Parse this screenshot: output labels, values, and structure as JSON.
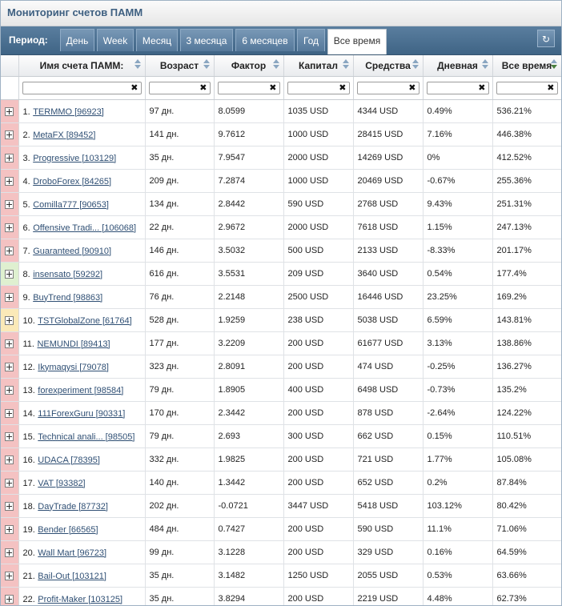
{
  "page": {
    "title": "Мониторинг счетов ПАММ"
  },
  "toolbar": {
    "period_label": "Период:",
    "tabs": [
      "День",
      "Week",
      "Месяц",
      "3 месяца",
      "6 месяцев",
      "Год",
      "Все время"
    ],
    "active_tab": "Все время",
    "refresh_icon": "refresh-icon"
  },
  "columns": [
    "Имя счета ПАММ:",
    "Возраст",
    "Фактор",
    "Капитал",
    "Средства",
    "Дневная",
    "Все время"
  ],
  "sorted_column": "Все время",
  "filters": [
    "",
    "",
    "",
    "",
    "",
    "",
    ""
  ],
  "row_colors": {
    "red": "#f4c2c2",
    "green": "#dff0d0",
    "yellow": "#fbe9b8"
  },
  "rows": [
    {
      "n": "1.",
      "name": "TERMMO [96923]",
      "age": "97 дн.",
      "factor": "8.0599",
      "capital": "1035 USD",
      "funds": "4344 USD",
      "daily": "0.49%",
      "all": "536.21%",
      "color": "red"
    },
    {
      "n": "2.",
      "name": "MetaFX [89452]",
      "age": "141 дн.",
      "factor": "9.7612",
      "capital": "1000 USD",
      "funds": "28415 USD",
      "daily": "7.16%",
      "all": "446.38%",
      "color": "red"
    },
    {
      "n": "3.",
      "name": "Progressive [103129]",
      "age": "35 дн.",
      "factor": "7.9547",
      "capital": "2000 USD",
      "funds": "14269 USD",
      "daily": "0%",
      "all": "412.52%",
      "color": "red"
    },
    {
      "n": "4.",
      "name": "DroboForex [84265]",
      "age": "209 дн.",
      "factor": "7.2874",
      "capital": "1000 USD",
      "funds": "20469 USD",
      "daily": "-0.67%",
      "all": "255.36%",
      "color": "red"
    },
    {
      "n": "5.",
      "name": "Comilla777 [90653]",
      "age": "134 дн.",
      "factor": "2.8442",
      "capital": "590 USD",
      "funds": "2768 USD",
      "daily": "9.43%",
      "all": "251.31%",
      "color": "red"
    },
    {
      "n": "6.",
      "name": "Offensive Tradi... [106068]",
      "age": "22 дн.",
      "factor": "2.9672",
      "capital": "2000 USD",
      "funds": "7618 USD",
      "daily": "1.15%",
      "all": "247.13%",
      "color": "red"
    },
    {
      "n": "7.",
      "name": "Guaranteed [90910]",
      "age": "146 дн.",
      "factor": "3.5032",
      "capital": "500 USD",
      "funds": "2133 USD",
      "daily": "-8.33%",
      "all": "201.17%",
      "color": "red"
    },
    {
      "n": "8.",
      "name": "insensato [59292]",
      "age": "616 дн.",
      "factor": "3.5531",
      "capital": "209 USD",
      "funds": "3640 USD",
      "daily": "0.54%",
      "all": "177.4%",
      "color": "green"
    },
    {
      "n": "9.",
      "name": "BuyTrend [98863]",
      "age": "76 дн.",
      "factor": "2.2148",
      "capital": "2500 USD",
      "funds": "16446 USD",
      "daily": "23.25%",
      "all": "169.2%",
      "color": "red"
    },
    {
      "n": "10.",
      "name": "TSTGlobalZone [61764]",
      "age": "528 дн.",
      "factor": "1.9259",
      "capital": "238 USD",
      "funds": "5038 USD",
      "daily": "6.59%",
      "all": "143.81%",
      "color": "yellow"
    },
    {
      "n": "11.",
      "name": "NEMUNDI [89413]",
      "age": "177 дн.",
      "factor": "3.2209",
      "capital": "200 USD",
      "funds": "61677 USD",
      "daily": "3.13%",
      "all": "138.86%",
      "color": "red"
    },
    {
      "n": "12.",
      "name": "Ikymaqysi [79078]",
      "age": "323 дн.",
      "factor": "2.8091",
      "capital": "200 USD",
      "funds": "474 USD",
      "daily": "-0.25%",
      "all": "136.27%",
      "color": "red"
    },
    {
      "n": "13.",
      "name": "forexperiment [98584]",
      "age": "79 дн.",
      "factor": "1.8905",
      "capital": "400 USD",
      "funds": "6498 USD",
      "daily": "-0.73%",
      "all": "135.2%",
      "color": "red"
    },
    {
      "n": "14.",
      "name": "111ForexGuru [90331]",
      "age": "170 дн.",
      "factor": "2.3442",
      "capital": "200 USD",
      "funds": "878 USD",
      "daily": "-2.64%",
      "all": "124.22%",
      "color": "red"
    },
    {
      "n": "15.",
      "name": "Technical anali... [98505]",
      "age": "79 дн.",
      "factor": "2.693",
      "capital": "300 USD",
      "funds": "662 USD",
      "daily": "0.15%",
      "all": "110.51%",
      "color": "red"
    },
    {
      "n": "16.",
      "name": "UDACA [78395]",
      "age": "332 дн.",
      "factor": "1.9825",
      "capital": "200 USD",
      "funds": "721 USD",
      "daily": "1.77%",
      "all": "105.08%",
      "color": "red"
    },
    {
      "n": "17.",
      "name": "VAT [93382]",
      "age": "140 дн.",
      "factor": "1.3442",
      "capital": "200 USD",
      "funds": "652 USD",
      "daily": "0.2%",
      "all": "87.84%",
      "color": "red"
    },
    {
      "n": "18.",
      "name": "DayTrade [87732]",
      "age": "202 дн.",
      "factor": "-0.0721",
      "capital": "3447 USD",
      "funds": "5418 USD",
      "daily": "103.12%",
      "all": "80.42%",
      "color": "red"
    },
    {
      "n": "19.",
      "name": "Bender [66565]",
      "age": "484 дн.",
      "factor": "0.7427",
      "capital": "200 USD",
      "funds": "590 USD",
      "daily": "11.1%",
      "all": "71.06%",
      "color": "red"
    },
    {
      "n": "20.",
      "name": "Wall Mart [96723]",
      "age": "99 дн.",
      "factor": "3.1228",
      "capital": "200 USD",
      "funds": "329 USD",
      "daily": "0.16%",
      "all": "64.59%",
      "color": "red"
    },
    {
      "n": "21.",
      "name": "Bail-Out [103121]",
      "age": "35 дн.",
      "factor": "3.1482",
      "capital": "1250 USD",
      "funds": "2055 USD",
      "daily": "0.53%",
      "all": "63.66%",
      "color": "red"
    },
    {
      "n": "22.",
      "name": "Profit-Maker [103125]",
      "age": "35 дн.",
      "factor": "3.8294",
      "capital": "200 USD",
      "funds": "2219 USD",
      "daily": "4.48%",
      "all": "62.73%",
      "color": "red"
    }
  ]
}
